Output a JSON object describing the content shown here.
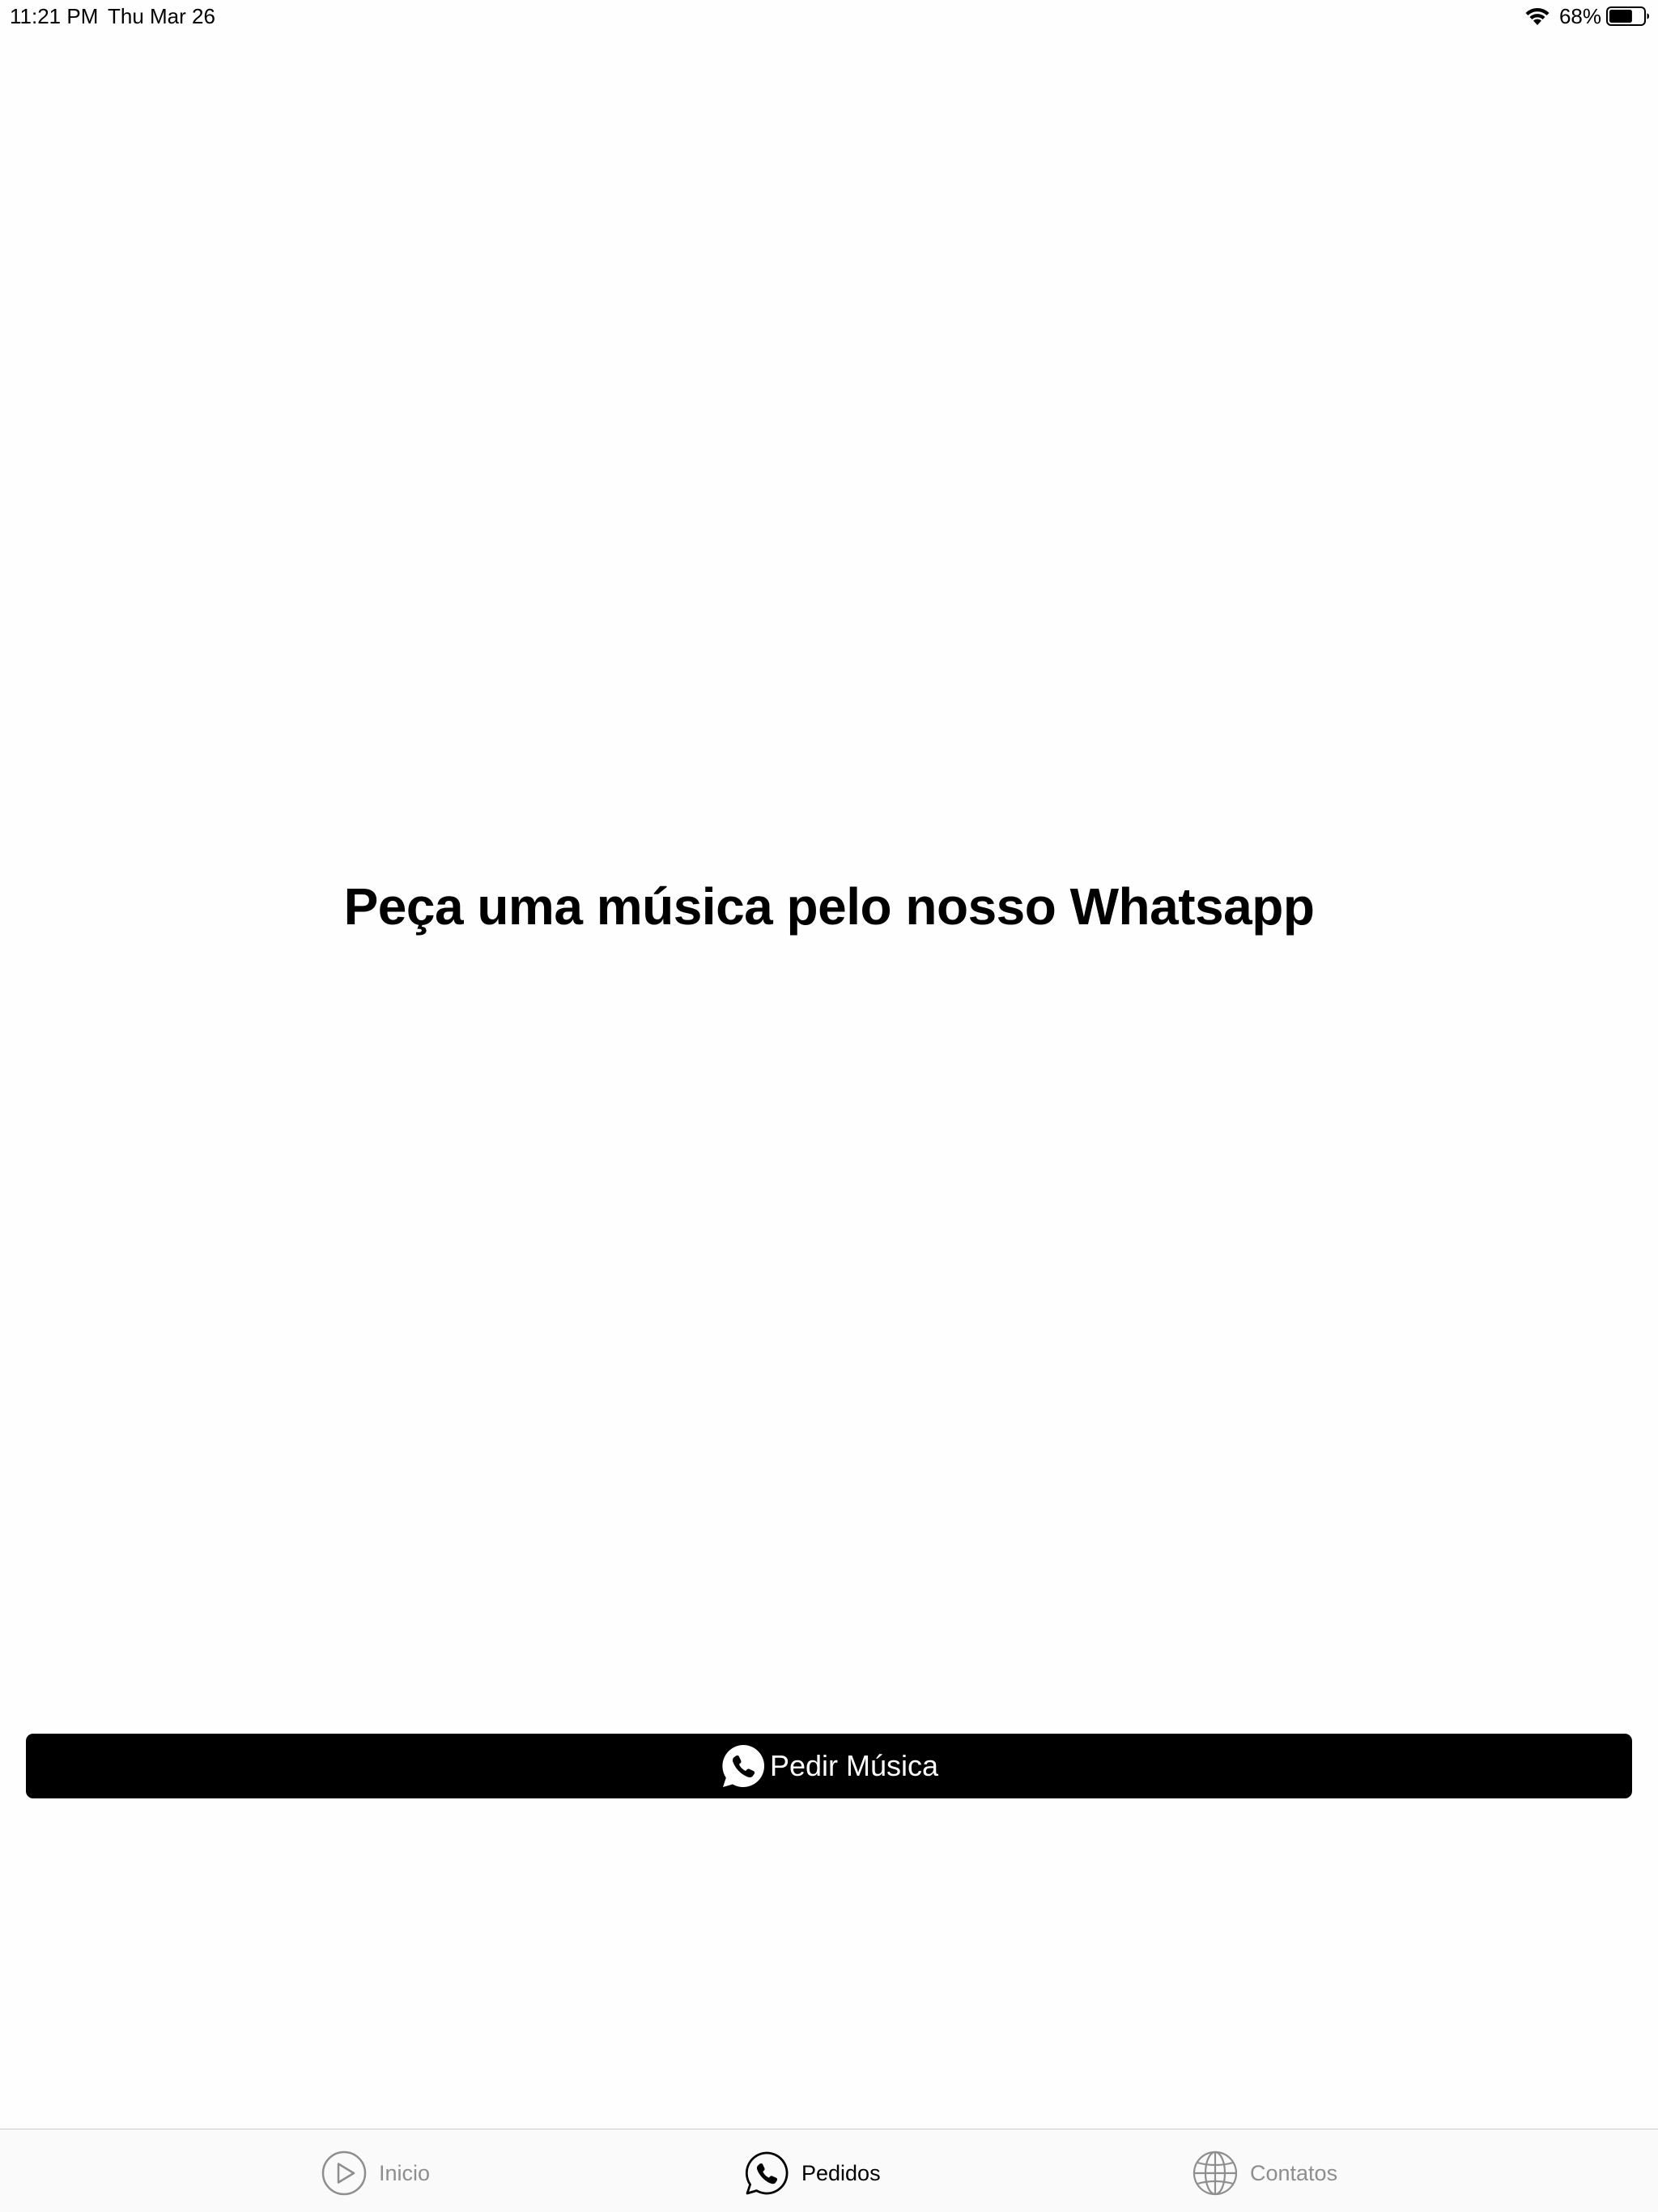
{
  "status_bar": {
    "time": "11:21 PM",
    "date": "Thu Mar 26",
    "battery_percent": "68%",
    "battery_level": 0.68,
    "wifi_icon": "wifi-icon",
    "battery_icon": "battery-icon"
  },
  "main": {
    "headline": "Peça uma música pelo nosso Whatsapp",
    "order_button": {
      "label": "Pedir Música",
      "icon": "whatsapp-icon",
      "background": "#000000",
      "text_color": "#ffffff"
    }
  },
  "tab_bar": {
    "active_color": "#000000",
    "inactive_color": "#8e8e8e",
    "tabs": [
      {
        "label": "Inicio",
        "icon": "play-circle-icon",
        "active": false
      },
      {
        "label": "Pedidos",
        "icon": "whatsapp-icon",
        "active": true
      },
      {
        "label": "Contatos",
        "icon": "globe-icon",
        "active": false
      }
    ]
  }
}
